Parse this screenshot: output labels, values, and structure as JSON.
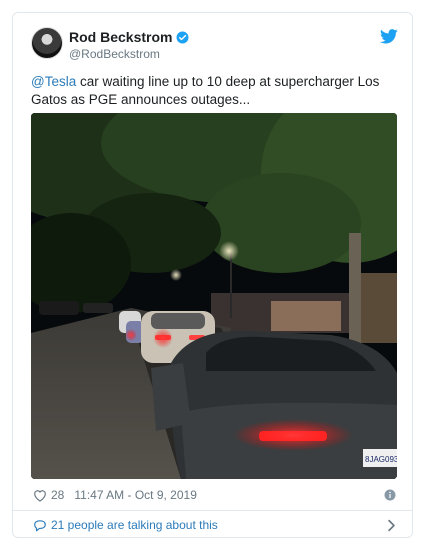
{
  "tweet": {
    "author_name": "Rod Beckstrom",
    "author_handle": "@RodBeckstrom",
    "mention": "@Tesla",
    "text": " car waiting line up to 10 deep at supercharger Los Gatos as PGE announces outages...",
    "license_plate": "8JAG093",
    "like_count": "28",
    "timestamp": "11:47 AM - Oct 9, 2019",
    "conversation_text": "21 people are talking about this"
  },
  "colors": {
    "link": "#2b7bb9",
    "text": "#1c2022",
    "secondary": "#697882",
    "verified": "#1da1f2",
    "twitter_blue": "#1da1f2"
  },
  "icons": {
    "verified": "verified-badge-icon",
    "brand": "twitter-bird-icon",
    "like": "heart-icon",
    "info": "info-icon",
    "conversation": "speech-bubble-icon",
    "more": "chevron-right-icon"
  }
}
